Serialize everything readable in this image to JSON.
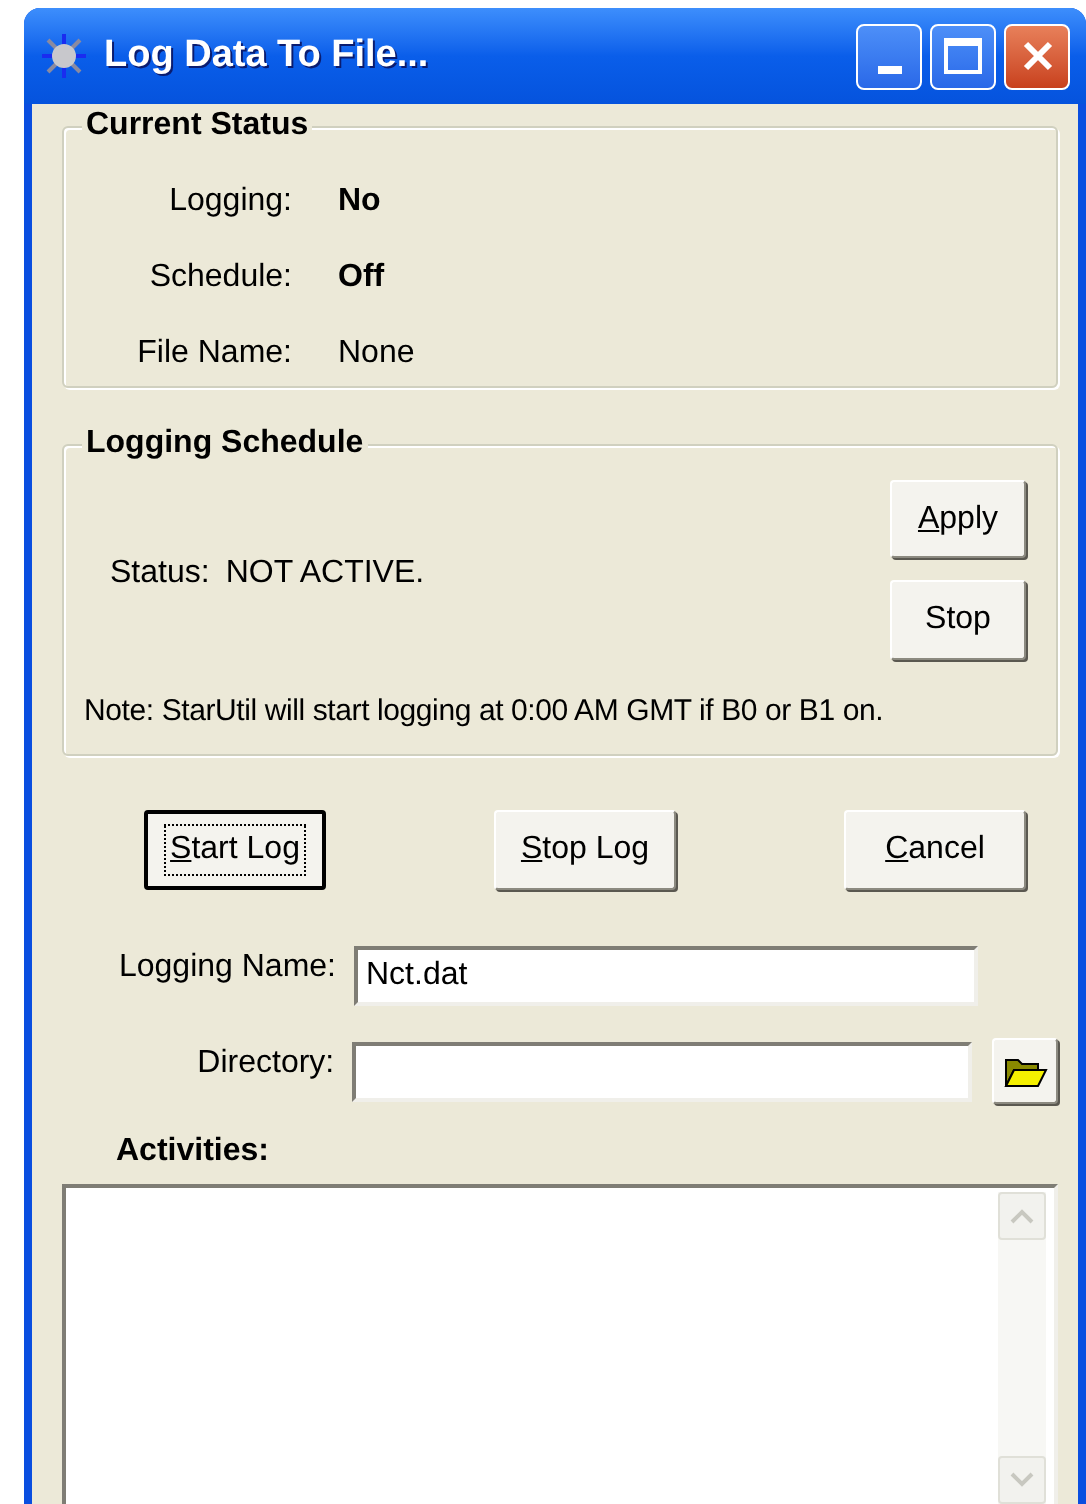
{
  "window": {
    "title": "Log Data To File..."
  },
  "current_status": {
    "title": "Current Status",
    "rows": [
      {
        "label": "Logging:",
        "value": "No",
        "bold": true
      },
      {
        "label": "Schedule:",
        "value": "Off",
        "bold": true
      },
      {
        "label": "File Name:",
        "value": "None",
        "bold": false
      }
    ]
  },
  "logging_schedule": {
    "title": "Logging Schedule",
    "status_label": "Status:",
    "status_value": "NOT ACTIVE.",
    "buttons": [
      {
        "label": "Apply",
        "mnemonic": true
      },
      {
        "label": "Stop",
        "mnemonic": false
      }
    ],
    "note": "Note: StarUtil will start logging at 0:00 AM GMT if B0 or B1 on."
  },
  "actions": [
    {
      "label": "Start Log",
      "mnemonic": true,
      "default": true
    },
    {
      "label": "Stop Log",
      "mnemonic": true,
      "default": false
    },
    {
      "label": "Cancel",
      "mnemonic": true,
      "default": false
    }
  ],
  "fields": [
    {
      "label": "Logging Name:",
      "value": "Nct.dat",
      "kind": "text"
    },
    {
      "label": "Directory:",
      "kind": "path"
    }
  ],
  "activities": {
    "label": "Activities:"
  }
}
